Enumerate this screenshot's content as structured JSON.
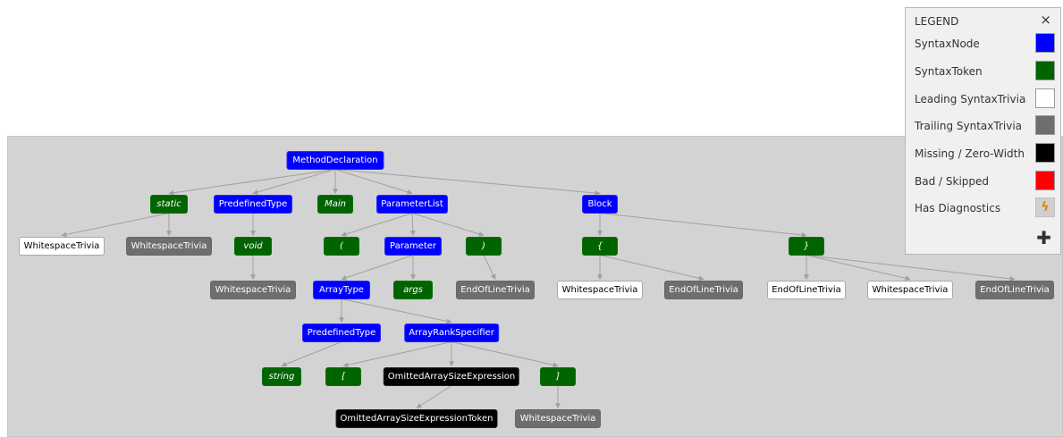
{
  "legend": {
    "title": "LEGEND",
    "close_icon": "×",
    "expand_icon": "✚",
    "items": [
      {
        "label": "SyntaxNode",
        "color": "#0000ff"
      },
      {
        "label": "SyntaxToken",
        "color": "#006400"
      },
      {
        "label": "Leading SyntaxTrivia",
        "color": "#ffffff"
      },
      {
        "label": "Trailing SyntaxTrivia",
        "color": "#6e6e6e"
      },
      {
        "label": "Missing / Zero-Width",
        "color": "#000000"
      },
      {
        "label": "Bad / Skipped",
        "color": "#ff0000"
      },
      {
        "label": "Has Diagnostics",
        "color": "#d0d0d0",
        "icon": "lightning-icon"
      }
    ]
  },
  "tree": {
    "nodes": [
      {
        "id": "n1",
        "label": "MethodDeclaration",
        "kind": "SyntaxNode"
      },
      {
        "id": "n2",
        "label": "static",
        "kind": "SyntaxToken"
      },
      {
        "id": "n3",
        "label": "PredefinedType",
        "kind": "SyntaxNode"
      },
      {
        "id": "n4",
        "label": "Main",
        "kind": "SyntaxToken"
      },
      {
        "id": "n5",
        "label": "ParameterList",
        "kind": "SyntaxNode"
      },
      {
        "id": "n6",
        "label": "Block",
        "kind": "SyntaxNode"
      },
      {
        "id": "n7",
        "label": "WhitespaceTrivia",
        "kind": "LeadingTrivia"
      },
      {
        "id": "n8",
        "label": "WhitespaceTrivia",
        "kind": "TrailingTrivia"
      },
      {
        "id": "n9",
        "label": "void",
        "kind": "SyntaxToken"
      },
      {
        "id": "n10",
        "label": "(",
        "kind": "SyntaxToken"
      },
      {
        "id": "n11",
        "label": "Parameter",
        "kind": "SyntaxNode"
      },
      {
        "id": "n12",
        "label": ")",
        "kind": "SyntaxToken"
      },
      {
        "id": "n13",
        "label": "{",
        "kind": "SyntaxToken"
      },
      {
        "id": "n14",
        "label": "}",
        "kind": "SyntaxToken"
      },
      {
        "id": "n15",
        "label": "WhitespaceTrivia",
        "kind": "TrailingTrivia"
      },
      {
        "id": "n16",
        "label": "ArrayType",
        "kind": "SyntaxNode"
      },
      {
        "id": "n17",
        "label": "args",
        "kind": "SyntaxToken"
      },
      {
        "id": "n18",
        "label": "EndOfLineTrivia",
        "kind": "TrailingTrivia"
      },
      {
        "id": "n19",
        "label": "WhitespaceTrivia",
        "kind": "LeadingTrivia"
      },
      {
        "id": "n20",
        "label": "EndOfLineTrivia",
        "kind": "TrailingTrivia"
      },
      {
        "id": "n21",
        "label": "EndOfLineTrivia",
        "kind": "LeadingTrivia"
      },
      {
        "id": "n22",
        "label": "WhitespaceTrivia",
        "kind": "LeadingTrivia"
      },
      {
        "id": "n23",
        "label": "EndOfLineTrivia",
        "kind": "TrailingTrivia"
      },
      {
        "id": "n24",
        "label": "PredefinedType",
        "kind": "SyntaxNode"
      },
      {
        "id": "n25",
        "label": "ArrayRankSpecifier",
        "kind": "SyntaxNode"
      },
      {
        "id": "n26",
        "label": "string",
        "kind": "SyntaxToken"
      },
      {
        "id": "n27",
        "label": "[",
        "kind": "SyntaxToken"
      },
      {
        "id": "n28",
        "label": "OmittedArraySizeExpression",
        "kind": "Missing"
      },
      {
        "id": "n29",
        "label": "]",
        "kind": "SyntaxToken"
      },
      {
        "id": "n30",
        "label": "OmittedArraySizeExpressionToken",
        "kind": "Missing"
      },
      {
        "id": "n31",
        "label": "WhitespaceTrivia",
        "kind": "TrailingTrivia"
      }
    ],
    "edges": [
      [
        "n1",
        "n2"
      ],
      [
        "n1",
        "n3"
      ],
      [
        "n1",
        "n4"
      ],
      [
        "n1",
        "n5"
      ],
      [
        "n1",
        "n6"
      ],
      [
        "n2",
        "n7"
      ],
      [
        "n2",
        "n8"
      ],
      [
        "n3",
        "n9"
      ],
      [
        "n9",
        "n15"
      ],
      [
        "n5",
        "n10"
      ],
      [
        "n5",
        "n11"
      ],
      [
        "n5",
        "n12"
      ],
      [
        "n12",
        "n18"
      ],
      [
        "n11",
        "n16"
      ],
      [
        "n11",
        "n17"
      ],
      [
        "n16",
        "n24"
      ],
      [
        "n16",
        "n25"
      ],
      [
        "n24",
        "n26"
      ],
      [
        "n25",
        "n27"
      ],
      [
        "n25",
        "n28"
      ],
      [
        "n25",
        "n29"
      ],
      [
        "n28",
        "n30"
      ],
      [
        "n29",
        "n31"
      ],
      [
        "n6",
        "n13"
      ],
      [
        "n6",
        "n14"
      ],
      [
        "n13",
        "n19"
      ],
      [
        "n13",
        "n20"
      ],
      [
        "n14",
        "n21"
      ],
      [
        "n14",
        "n22"
      ],
      [
        "n14",
        "n23"
      ]
    ]
  }
}
